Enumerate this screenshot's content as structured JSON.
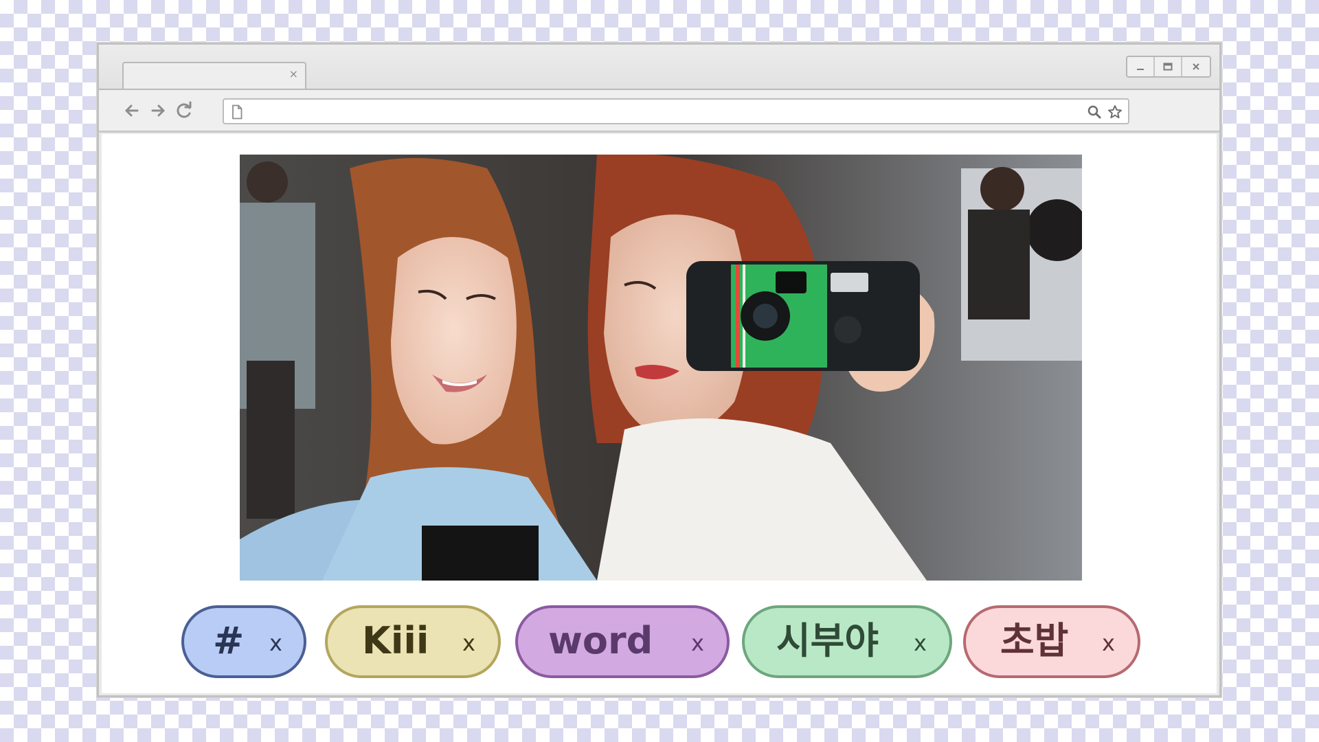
{
  "browser": {
    "tab_close": "×",
    "window_controls": {
      "minimize": "_",
      "maximize": "▭",
      "close": "×"
    },
    "url": {
      "value": ""
    },
    "icons": [
      "back-arrow-icon",
      "forward-arrow-icon",
      "reload-icon",
      "page-icon",
      "search-icon",
      "star-icon"
    ]
  },
  "tags": [
    {
      "label": "#",
      "remove": "x",
      "fill": "#b9ccf5",
      "border": "#4a5f94",
      "text": "#2a3553"
    },
    {
      "label": "Kiii",
      "remove": "x",
      "fill": "#ebe3b4",
      "border": "#b3a65c",
      "text": "#3f3816"
    },
    {
      "label": "word",
      "remove": "x",
      "fill": "#d3a9e2",
      "border": "#8a5aa0",
      "text": "#5a3a6a"
    },
    {
      "label": "시부야",
      "remove": "x",
      "fill": "#b9e8c6",
      "border": "#6da67d",
      "text": "#2f4a37"
    },
    {
      "label": "초밥",
      "remove": "x",
      "fill": "#fbd9db",
      "border": "#b66a70",
      "text": "#5f3236"
    }
  ],
  "colors": {
    "window_border": "#c2c2c2",
    "checker": "#d9d9ef"
  }
}
